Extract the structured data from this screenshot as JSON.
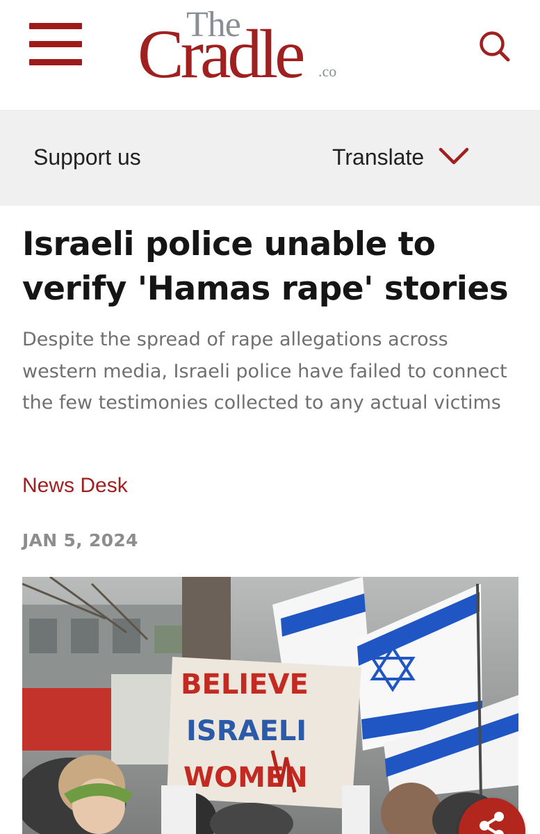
{
  "header": {
    "logo": {
      "the": "The",
      "cradle": "Cradle",
      "suffix": ".co"
    },
    "menu_icon": "hamburger-menu-icon",
    "search_icon": "search-icon"
  },
  "util_bar": {
    "support_label": "Support us",
    "translate_label": "Translate",
    "translate_icon": "chevron-down-icon"
  },
  "article": {
    "headline": "Israeli police unable to verify 'Hamas rape' stories",
    "dek": "Despite the spread of rape allegations across western media, Israeli police have failed to connect the few testimonies collected to any actual victims",
    "author": "News Desk",
    "date": "JAN 5, 2024",
    "image": {
      "sign_lines": [
        "BELIEVE",
        "ISRAELI",
        "WOMEN"
      ]
    }
  },
  "share_icon": "share-icon",
  "colors": {
    "brand_red": "#a01f1f",
    "logo_grey": "#8a8f96",
    "util_bar_bg": "#f0f0f0",
    "dek_grey": "#707070",
    "date_grey": "#8d8d8d",
    "flag_blue": "#1f56c4"
  }
}
